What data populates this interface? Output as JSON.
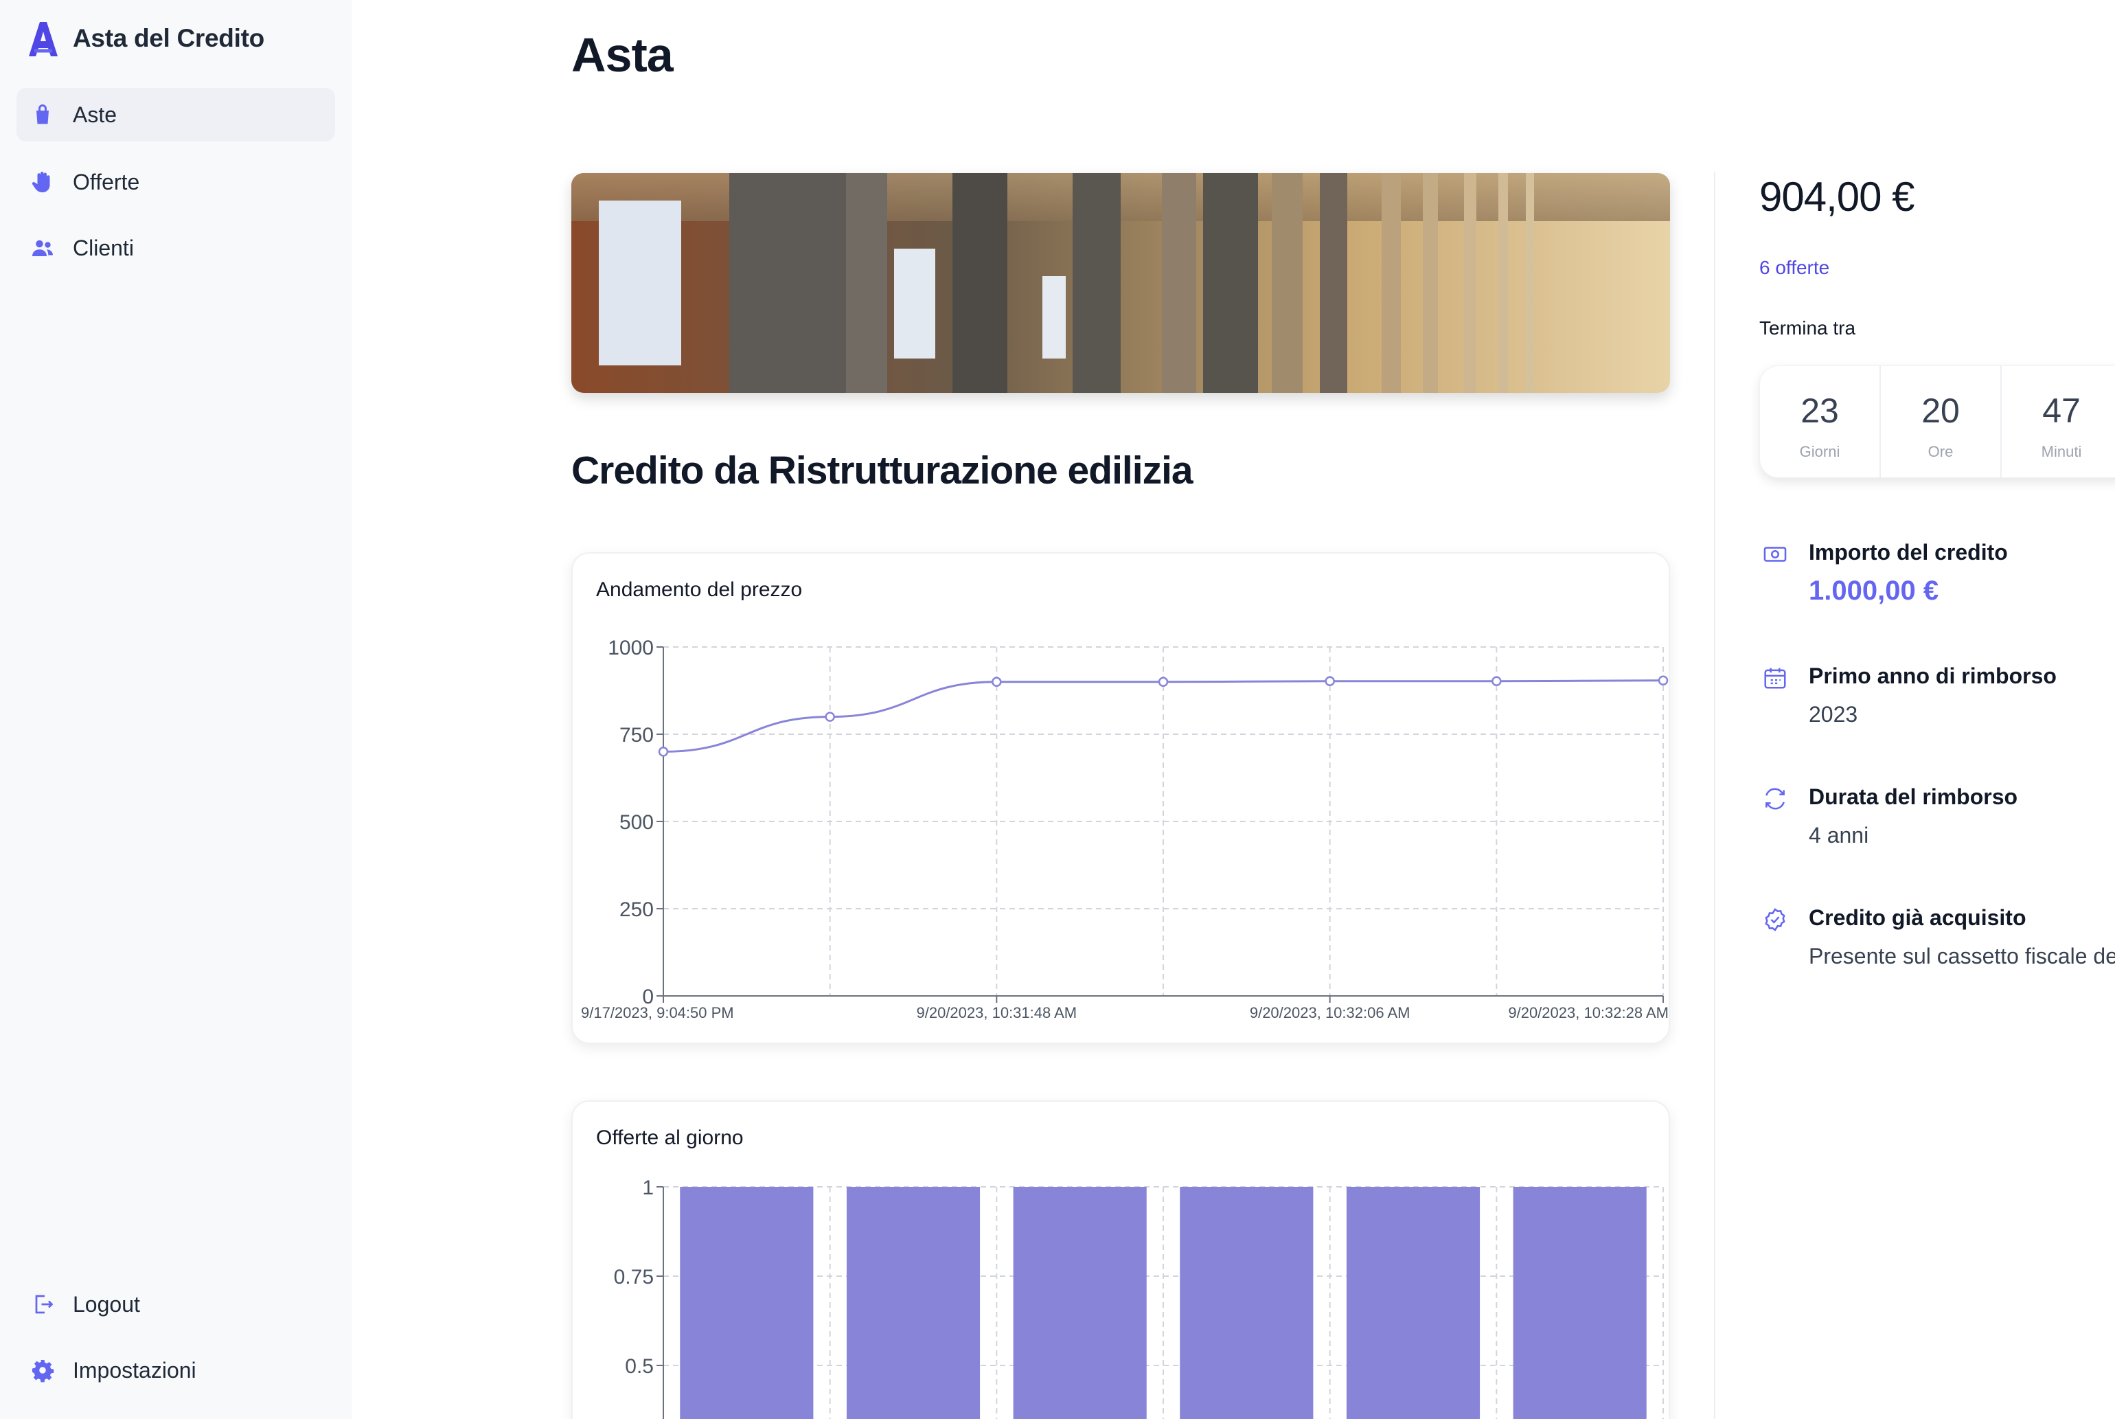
{
  "app": {
    "name": "Asta del Credito"
  },
  "sidebar": {
    "items": [
      {
        "label": "Aste",
        "icon": "shopping-bag-icon",
        "active": true
      },
      {
        "label": "Offerte",
        "icon": "hand-icon"
      },
      {
        "label": "Clienti",
        "icon": "users-icon"
      }
    ],
    "bottom": [
      {
        "label": "Logout",
        "icon": "logout-icon"
      },
      {
        "label": "Impostazioni",
        "icon": "gear-icon"
      }
    ]
  },
  "main": {
    "title": "Asta",
    "credit_title": "Credito da Ristrutturazione edilizia"
  },
  "panel": {
    "price": "904,00 €",
    "offers": "6 offerte",
    "ends_label": "Termina tra",
    "countdown": [
      {
        "value": "23",
        "unit": "Giorni"
      },
      {
        "value": "20",
        "unit": "Ore"
      },
      {
        "value": "47",
        "unit": "Minuti"
      }
    ],
    "info": [
      {
        "label": "Importo del credito",
        "value": "1.000,00 €",
        "icon": "banknote-icon"
      },
      {
        "label": "Primo anno di rimborso",
        "value": "2023",
        "icon": "calendar-icon"
      },
      {
        "label": "Durata del rimborso",
        "value": "4 anni",
        "icon": "refresh-icon"
      },
      {
        "label": "Credito già acquisito",
        "value": "Presente sul cassetto fiscale de",
        "icon": "check-badge-icon"
      }
    ]
  },
  "colors": {
    "accent": "#6366f1",
    "series": "#8884d8",
    "sidebar_bg": "#f8f9fb"
  },
  "chart_data": [
    {
      "type": "line",
      "title": "Andamento del prezzo",
      "x": [
        "9/17/2023, 9:04:50 PM",
        "",
        "9/20/2023, 10:31:48 AM",
        "",
        "9/20/2023, 10:32:06 AM",
        "",
        "9/20/2023, 10:32:28 AM"
      ],
      "y": [
        700,
        800,
        900,
        900,
        902,
        902,
        904
      ],
      "yticks": [
        "0",
        "250",
        "500",
        "750",
        "1000"
      ],
      "ylim": [
        0,
        1000
      ],
      "grid": true
    },
    {
      "type": "bar",
      "title": "Offerte al giorno",
      "categories": [
        "",
        "",
        "",
        "",
        "",
        ""
      ],
      "values": [
        1,
        1,
        1,
        1,
        1,
        1
      ],
      "yticks": [
        "0.5",
        "0.75",
        "1"
      ],
      "ylim": [
        0,
        1
      ],
      "grid": true
    }
  ]
}
